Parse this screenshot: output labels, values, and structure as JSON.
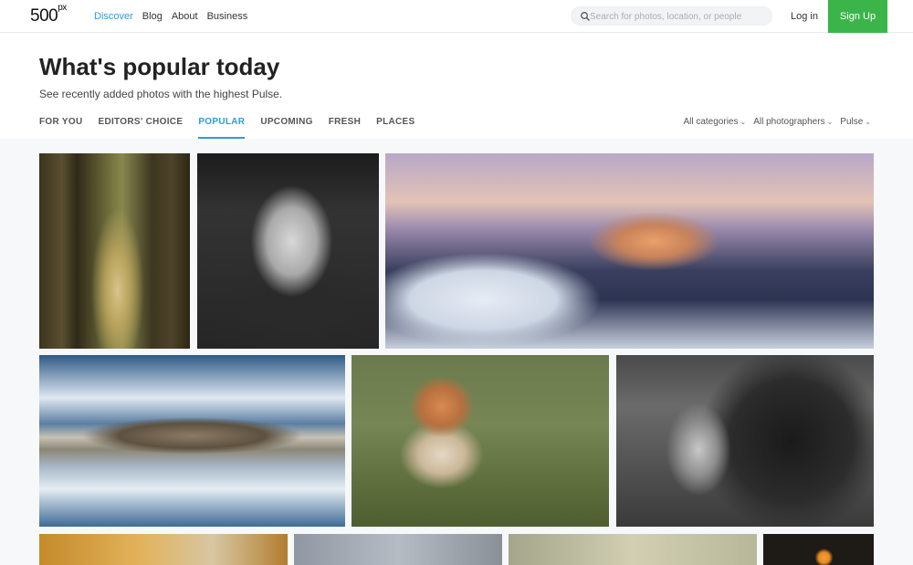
{
  "app": {
    "logo": "500",
    "logo_sup": "px"
  },
  "nav": {
    "items": [
      {
        "label": "Discover",
        "active": true
      },
      {
        "label": "Blog"
      },
      {
        "label": "About"
      },
      {
        "label": "Business"
      }
    ]
  },
  "search": {
    "placeholder": "Search for photos, location, or people",
    "value": ""
  },
  "auth": {
    "login": "Log in",
    "signup": "Sign Up"
  },
  "header": {
    "title": "What's popular today",
    "subtitle": "See recently added photos with the highest Pulse."
  },
  "tabs": [
    {
      "label": "FOR YOU"
    },
    {
      "label": "EDITORS' CHOICE"
    },
    {
      "label": "POPULAR",
      "active": true
    },
    {
      "label": "UPCOMING"
    },
    {
      "label": "FRESH"
    },
    {
      "label": "PLACES"
    }
  ],
  "filters": [
    {
      "label": "All categories"
    },
    {
      "label": "All photographers"
    },
    {
      "label": "Pulse"
    }
  ],
  "colors": {
    "accent": "#2d9cdb",
    "signup": "#3bb54a"
  },
  "icons": {
    "search": "search-icon",
    "chevron": "chevron-down-icon"
  }
}
